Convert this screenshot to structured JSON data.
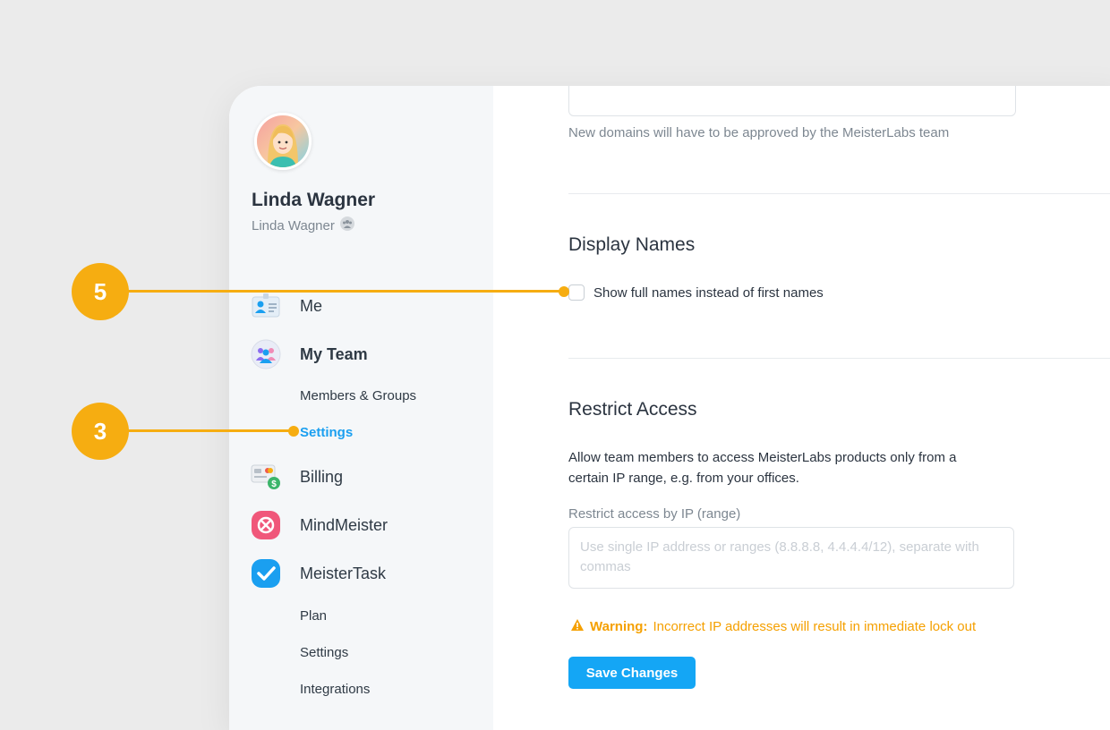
{
  "user": {
    "name": "Linda Wagner",
    "subtitle": "Linda Wagner"
  },
  "sidebar": {
    "items": [
      {
        "label": "Me",
        "icon": "profile-card-icon"
      },
      {
        "label": "My Team",
        "icon": "team-icon"
      },
      {
        "label": "Billing",
        "icon": "billing-icon"
      },
      {
        "label": "MindMeister",
        "icon": "mindmeister-icon"
      },
      {
        "label": "MeisterTask",
        "icon": "meistertask-icon"
      }
    ],
    "team_sub": [
      "Members & Groups",
      "Settings"
    ],
    "task_sub": [
      "Plan",
      "Settings",
      "Integrations"
    ]
  },
  "main": {
    "domains_hint": "New domains will have to be approved by the MeisterLabs team",
    "display_names": {
      "title": "Display Names",
      "checkbox_label": "Show full names instead of first names"
    },
    "restrict": {
      "title": "Restrict Access",
      "description": "Allow team members to access MeisterLabs products only from a certain IP range, e.g. from your offices.",
      "field_label": "Restrict access by IP (range)",
      "placeholder": "Use single IP address or ranges (8.8.8.8, 4.4.4.4/12), separate with commas",
      "warning_prefix": "Warning:",
      "warning_text": "Incorrect IP addresses will result in immediate lock out",
      "save_label": "Save Changes"
    }
  },
  "callouts": [
    "5",
    "3"
  ],
  "colors": {
    "accent": "#14a6f5",
    "active_link": "#1a9ff0",
    "callout": "#f6ad11",
    "warning": "#f5a000"
  }
}
